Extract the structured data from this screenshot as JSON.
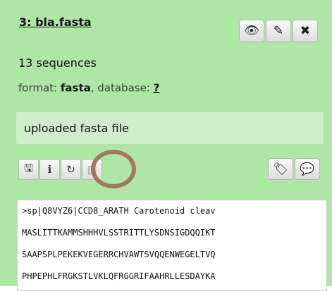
{
  "dataset": {
    "title": "3: bla.fasta",
    "sequence_count": "13 sequences",
    "format_label": "format:",
    "format_value": "fasta",
    "database_label": ", database:",
    "database_value": "?",
    "info": "uploaded fasta file"
  },
  "header_buttons": [
    {
      "icon": "eye-icon",
      "glyph": "👁"
    },
    {
      "icon": "pencil-icon",
      "glyph": "✎"
    },
    {
      "icon": "close-icon",
      "glyph": "✖"
    }
  ],
  "toolbar_left": [
    {
      "icon": "save-icon",
      "glyph": "🖫"
    },
    {
      "icon": "info-icon",
      "glyph": "ℹ"
    },
    {
      "icon": "rerun-icon",
      "glyph": "↻"
    },
    {
      "icon": "visualize-icon",
      "glyph": "▥"
    }
  ],
  "toolbar_right": [
    {
      "icon": "tags-icon",
      "glyph": "🏷"
    },
    {
      "icon": "comment-icon",
      "glyph": "💬"
    }
  ],
  "peek": {
    "lines": [
      ">sp|Q8VYZ6|CCD8_ARATH Carotenoid cleav",
      "MASLITTKAMMSHHHVLSSTRITTLYSDNSIGDQQIKT",
      "SAAPSPLPEKEKVEGERRCHVAWTSVQQENWEGELTVQ",
      "PHPEPHLFRGKSTLVKLQFRGGRIFAAHRLLESDAYKA"
    ]
  },
  "colors": {
    "panel_bg": "#aee6a6",
    "info_bg": "#cdeec8",
    "highlight_ring": "#a27a5a"
  }
}
